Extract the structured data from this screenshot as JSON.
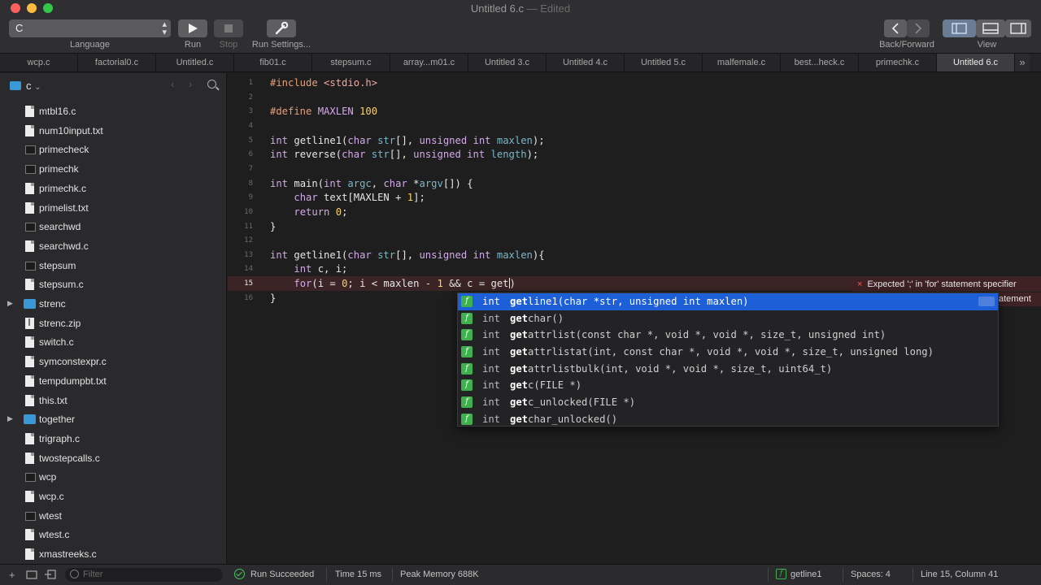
{
  "window": {
    "title": "Untitled 6.c",
    "title_suffix": " — Edited"
  },
  "toolbar": {
    "language_value": "C",
    "language_label": "Language",
    "run_label": "Run",
    "stop_label": "Stop",
    "settings_label": "Run Settings...",
    "backforward_label": "Back/Forward",
    "view_label": "View"
  },
  "tabs": [
    "wcp.c",
    "factorial0.c",
    "Untitled.c",
    "fib01.c",
    "stepsum.c",
    "array...m01.c",
    "Untitled 3.c",
    "Untitled 4.c",
    "Untitled 5.c",
    "malfemale.c",
    "best...heck.c",
    "primechk.c",
    "Untitled 6.c"
  ],
  "active_tab_index": 12,
  "tab_overflow_glyph": "»",
  "sidebar": {
    "root": "c",
    "root_chevron": "⌄",
    "files": [
      {
        "name": "mtbl16.c",
        "kind": "doc"
      },
      {
        "name": "num10input.txt",
        "kind": "doc"
      },
      {
        "name": "primecheck",
        "kind": "exec"
      },
      {
        "name": "primechk",
        "kind": "exec"
      },
      {
        "name": "primechk.c",
        "kind": "doc"
      },
      {
        "name": "primelist.txt",
        "kind": "doc"
      },
      {
        "name": "searchwd",
        "kind": "exec"
      },
      {
        "name": "searchwd.c",
        "kind": "doc"
      },
      {
        "name": "stepsum",
        "kind": "exec"
      },
      {
        "name": "stepsum.c",
        "kind": "doc"
      },
      {
        "name": "strenc",
        "kind": "folder"
      },
      {
        "name": "strenc.zip",
        "kind": "zip"
      },
      {
        "name": "switch.c",
        "kind": "doc"
      },
      {
        "name": "symconstexpr.c",
        "kind": "doc"
      },
      {
        "name": "tempdumpbt.txt",
        "kind": "doc"
      },
      {
        "name": "this.txt",
        "kind": "doc"
      },
      {
        "name": "together",
        "kind": "folder"
      },
      {
        "name": "trigraph.c",
        "kind": "doc"
      },
      {
        "name": "twostepcalls.c",
        "kind": "doc"
      },
      {
        "name": "wcp",
        "kind": "exec"
      },
      {
        "name": "wcp.c",
        "kind": "doc"
      },
      {
        "name": "wtest",
        "kind": "exec"
      },
      {
        "name": "wtest.c",
        "kind": "doc"
      },
      {
        "name": "xmastreeks.c",
        "kind": "doc"
      }
    ]
  },
  "editor": {
    "error_line": 15,
    "lines": [
      {
        "n": "1",
        "html": "<span class=\"pp\">#include</span> <span class=\"inc\">&lt;stdio.h&gt;</span>"
      },
      {
        "n": "2",
        "html": ""
      },
      {
        "n": "3",
        "html": "<span class=\"pp\">#define</span> <span class=\"kw\">MAXLEN</span> <span class=\"num\">100</span>"
      },
      {
        "n": "4",
        "html": ""
      },
      {
        "n": "5",
        "html": "<span class=\"kw\">int</span> getline1(<span class=\"kw\">char</span> <span class=\"param\">str</span>[], <span class=\"kw\">unsigned int</span> <span class=\"param\">maxlen</span>);"
      },
      {
        "n": "6",
        "html": "<span class=\"kw\">int</span> reverse(<span class=\"kw\">char</span> <span class=\"param\">str</span>[], <span class=\"kw\">unsigned int</span> <span class=\"param\">length</span>);"
      },
      {
        "n": "7",
        "html": ""
      },
      {
        "n": "8",
        "html": "<span class=\"kw\">int</span> main(<span class=\"kw\">int</span> <span class=\"param\">argc</span>, <span class=\"kw\">char</span> *<span class=\"param\">argv</span>[]) {"
      },
      {
        "n": "9",
        "html": "    <span class=\"kw\">char</span> text[MAXLEN + <span class=\"num\">1</span>];"
      },
      {
        "n": "10",
        "html": "    <span class=\"kw\">return</span> <span class=\"num\">0</span>;"
      },
      {
        "n": "11",
        "html": "}"
      },
      {
        "n": "12",
        "html": ""
      },
      {
        "n": "13",
        "html": "<span class=\"kw\">int</span> getline1(<span class=\"kw\">char</span> <span class=\"param\">str</span>[], <span class=\"kw\">unsigned int</span> <span class=\"param\">maxlen</span>){"
      },
      {
        "n": "14",
        "html": "    <span class=\"kw\">int</span> c, i;"
      },
      {
        "n": "15",
        "html": "    <span class=\"kw\">for</span>(i = <span class=\"num\">0</span>; i &lt; maxlen - <span class=\"num\">1</span> &amp;&amp; c = get<span class=\"cursor\"></span>)"
      },
      {
        "n": "16",
        "html": "}"
      }
    ],
    "error_message": "Expected ';' in 'for' statement specifier",
    "error_message_2": "atement",
    "error_glyph": "×"
  },
  "completion": {
    "typed_prefix": "get",
    "items": [
      {
        "type": "int",
        "match": "get",
        "rest": "line1(char *str, unsigned int maxlen)",
        "selected": true
      },
      {
        "type": "int",
        "match": "get",
        "rest": "char()",
        "selected": false
      },
      {
        "type": "int",
        "match": "get",
        "rest": "attrlist(const char *, void *, void *, size_t, unsigned int)",
        "selected": false
      },
      {
        "type": "int",
        "match": "get",
        "rest": "attrlistat(int, const char *, void *, void *, size_t, unsigned long)",
        "selected": false
      },
      {
        "type": "int",
        "match": "get",
        "rest": "attrlistbulk(int, void *, void *, size_t, uint64_t)",
        "selected": false
      },
      {
        "type": "int",
        "match": "get",
        "rest": "c(FILE *)",
        "selected": false
      },
      {
        "type": "int",
        "match": "get",
        "rest": "c_unlocked(FILE *)",
        "selected": false
      },
      {
        "type": "int",
        "match": "get",
        "rest": "char_unlocked()",
        "selected": false
      }
    ],
    "badge_glyph": "f"
  },
  "statusbar": {
    "filter_placeholder": "Filter",
    "run_status": "Run Succeeded",
    "time": "Time 15 ms",
    "memory": "Peak Memory 688K",
    "symbol": "getline1",
    "spaces": "Spaces: 4",
    "position": "Line 15, Column 41"
  },
  "colors": {
    "accent": "#1c5fd6",
    "error_bg": "#3b2425",
    "success": "#45c55a"
  }
}
